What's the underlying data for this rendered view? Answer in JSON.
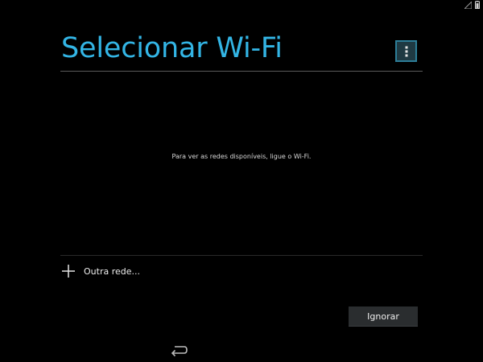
{
  "header": {
    "title": "Selecionar Wi-Fi"
  },
  "content": {
    "empty_message": "Para ver as redes disponíveis, ligue o Wi-Fi."
  },
  "actions": {
    "other_network_label": "Outra rede...",
    "skip_label": "Ignorar"
  },
  "icons": {
    "menu": "overflow-menu-icon",
    "add": "plus-icon",
    "back": "back-icon",
    "signal": "signal-icon",
    "battery": "battery-icon"
  },
  "colors": {
    "accent": "#33b5e5",
    "background": "#000000",
    "button": "#2a2d2f"
  }
}
